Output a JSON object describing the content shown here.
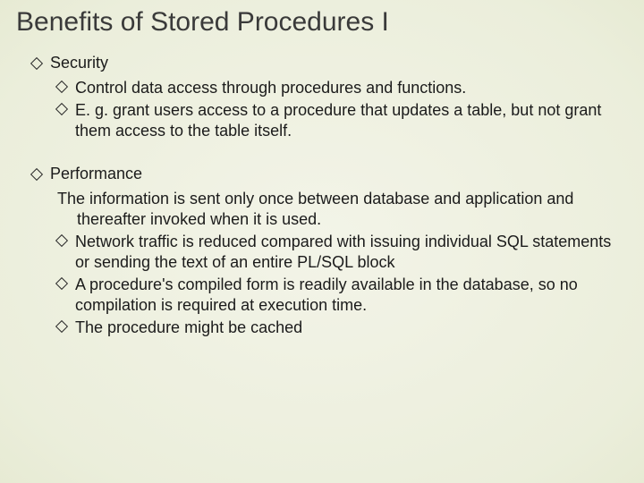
{
  "title": "Benefits of Stored Procedures I",
  "sections": [
    {
      "heading": "Security",
      "items": [
        {
          "bullet": true,
          "text": "Control data access through procedures and functions."
        },
        {
          "bullet": true,
          "text": "E. g. grant users access to a procedure that updates a table, but not grant them access to the table itself."
        }
      ]
    },
    {
      "heading": "Performance",
      "items": [
        {
          "bullet": false,
          "text": "The  information is sent only once between database and application and thereafter invoked when it is used."
        },
        {
          "bullet": true,
          "text": "Network traffic is reduced compared with issuing individual SQL statements or sending the text of an entire PL/SQL block"
        },
        {
          "bullet": true,
          "text": "A procedure's compiled form is readily available in the database, so no compilation is required at execution time."
        },
        {
          "bullet": true,
          "text": "The procedure might be cached"
        }
      ]
    }
  ]
}
